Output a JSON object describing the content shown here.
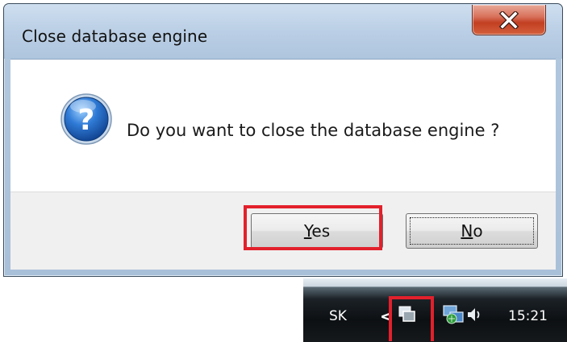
{
  "dialog": {
    "title": "Close database engine",
    "message": "Do you want to close the database engine ?",
    "close_icon": "close-icon",
    "question_icon": "question-icon",
    "buttons": {
      "yes_prefix": "Y",
      "yes_rest": "es",
      "no_prefix": "N",
      "no_rest": "o"
    }
  },
  "taskbar": {
    "language": "SK",
    "chevron": "<",
    "time": "15:21",
    "icons": [
      "show-hidden-icons-chevron",
      "windows-switcher-icon",
      "network-icon",
      "speaker-icon"
    ]
  },
  "colors": {
    "highlight": "#e2202c",
    "close_button": "#c23f22",
    "title_bar": "#b2c8df",
    "question_icon": "#1f5fb5"
  }
}
